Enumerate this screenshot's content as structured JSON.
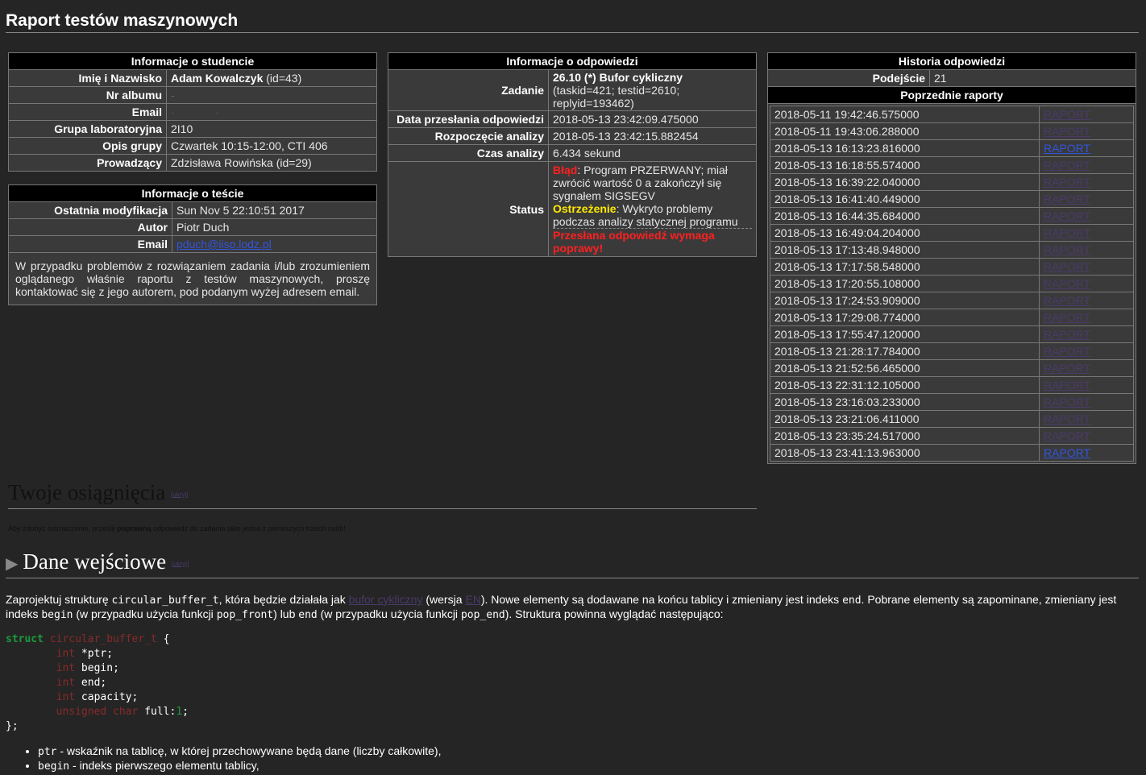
{
  "page": {
    "title": "Raport testów maszynowych"
  },
  "student": {
    "header": "Informacje o studencie",
    "rows": [
      {
        "label": "Imię i Nazwisko",
        "value": "Adam Kowalczyk",
        "suffix": " (id=43)"
      },
      {
        "label": "Nr albumu",
        "value": "-"
      },
      {
        "label": "Email",
        "value": ""
      },
      {
        "label": "Grupa laboratoryjna",
        "value": "2I10"
      },
      {
        "label": "Opis grupy",
        "value": "Czwartek 10:15-12:00, CTI 406"
      },
      {
        "label": "Prowadzący",
        "value": "Zdzisława Rowińska (id=29)"
      }
    ]
  },
  "test": {
    "header": "Informacje o teście",
    "rows": [
      {
        "label": "Ostatnia modyfikacja",
        "value": "Sun Nov 5 22:10:51 2017"
      },
      {
        "label": "Autor",
        "value": "Piotr Duch"
      },
      {
        "label": "Email",
        "value": "pduch@iisp.lodz.pl"
      }
    ],
    "note": "W przypadku problemów z rozwiązaniem zadania i/lub zrozumieniem oglądanego właśnie raportu z testów maszynowych, proszę kontaktować się z jego autorem, pod podanym wyżej adresem email."
  },
  "answer": {
    "header": "Informacje o odpowiedzi",
    "task_label": "Zadanie",
    "task_title": "26.10 (*) Bufor cykliczny",
    "task_ids": "(taskid=421; testid=2610; replyid=193462)",
    "rows": [
      {
        "label": "Data przesłania odpowiedzi",
        "value": "2018-05-13 23:42:09.475000"
      },
      {
        "label": "Rozpoczęcie analizy",
        "value": "2018-05-13 23:42:15.882454"
      },
      {
        "label": "Czas analizy",
        "value": "6.434 sekund"
      }
    ],
    "status_label": "Status",
    "error_word": "Błąd",
    "error_text": ": Program PRZERWANY; miał zwrócić wartość 0 a zakończył się sygnałem SIGSEGV",
    "warn_word": "Ostrzeżenie",
    "warn_text": ": Wykryto problemy podczas analizy statycznej programu",
    "needs_fix": "Przesłana odpowiedź wymaga poprawy!"
  },
  "history": {
    "header": "Historia odpowiedzi",
    "attempt_label": "Podejście",
    "attempt_value": "21",
    "prev_header": "Poprzednie raporty",
    "link_label": "RAPORT",
    "reports": [
      {
        "date": "2018-05-11 19:42:46.575000",
        "active": false
      },
      {
        "date": "2018-05-11 19:43:06.288000",
        "active": false
      },
      {
        "date": "2018-05-13 16:13:23.816000",
        "active": true
      },
      {
        "date": "2018-05-13 16:18:55.574000",
        "active": false
      },
      {
        "date": "2018-05-13 16:39:22.040000",
        "active": false
      },
      {
        "date": "2018-05-13 16:41:40.449000",
        "active": false
      },
      {
        "date": "2018-05-13 16:44:35.684000",
        "active": false
      },
      {
        "date": "2018-05-13 16:49:04.204000",
        "active": false
      },
      {
        "date": "2018-05-13 17:13:48.948000",
        "active": false
      },
      {
        "date": "2018-05-13 17:17:58.548000",
        "active": false
      },
      {
        "date": "2018-05-13 17:20:55.108000",
        "active": false
      },
      {
        "date": "2018-05-13 17:24:53.909000",
        "active": false
      },
      {
        "date": "2018-05-13 17:29:08.774000",
        "active": false
      },
      {
        "date": "2018-05-13 17:55:47.120000",
        "active": false
      },
      {
        "date": "2018-05-13 21:28:17.784000",
        "active": false
      },
      {
        "date": "2018-05-13 21:52:56.465000",
        "active": false
      },
      {
        "date": "2018-05-13 22:31:12.105000",
        "active": false
      },
      {
        "date": "2018-05-13 23:16:03.233000",
        "active": false
      },
      {
        "date": "2018-05-13 23:21:06.411000",
        "active": false
      },
      {
        "date": "2018-05-13 23:35:24.517000",
        "active": false
      },
      {
        "date": "2018-05-13 23:41:13.963000",
        "active": true
      }
    ]
  },
  "achievements": {
    "title": "Twoje osiągnięcia",
    "toggle": "ukryj",
    "note_pre": "Aby zdobyć odznaczenie, prześlij ",
    "note_bold": "poprawną",
    "note_post": " odpowiedź do zadania jako jedna z pierwszych trzech osób!"
  },
  "input_data": {
    "title": "Dane wejściowe",
    "toggle": "ukryj",
    "p1": "Zaprojektuj strukturę ",
    "p1_code": "circular_buffer_t",
    "p2": ", która będzie działała jak ",
    "p2_link": "bufor cykliczny",
    "p3": " (wersja ",
    "p3_link": "EN",
    "p4": "). Nowe elementy są dodawane na końcu tablicy i zmieniany jest indeks ",
    "p4_code": "end",
    "p5": ". Pobrane elementy są zapominane, zmieniany jest indeks ",
    "p5_code": "begin",
    "p6": " (w przypadku użycia funkcji ",
    "p6_code": "pop_front",
    "p7": ") lub ",
    "p7_code": "end",
    "p8": " (w przypadku użycia funkcji ",
    "p8_code": "pop_end",
    "p9": "). Struktura powinna wyglądać następująco:",
    "code": {
      "kw_struct": "struct",
      "type_name": "circular_buffer_t",
      "open": " {",
      "fields": [
        {
          "type": "int",
          "name": " *ptr;"
        },
        {
          "type": "int",
          "name": " begin;"
        },
        {
          "type": "int",
          "name": " end;"
        },
        {
          "type": "int",
          "name": " capacity;"
        },
        {
          "type": "unsigned char",
          "name": " full:",
          "num": "1",
          "end": ";"
        }
      ],
      "close": "};"
    },
    "bullets": [
      {
        "code": "ptr",
        "text": " - wskaźnik na tablicę, w której przechowywane będą dane (liczby całkowite),"
      },
      {
        "code": "begin",
        "text": " - indeks pierwszego elementu tablicy,"
      }
    ]
  }
}
